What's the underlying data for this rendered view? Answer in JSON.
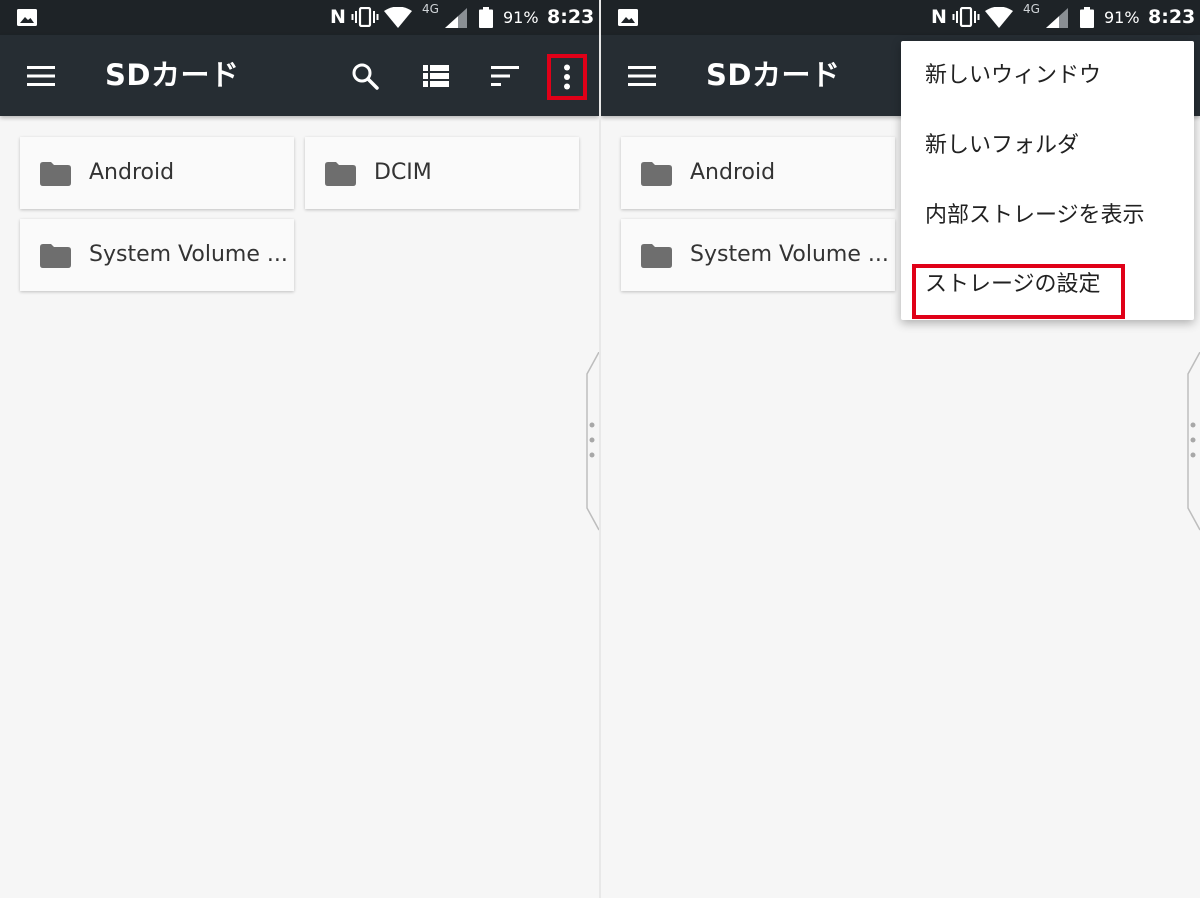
{
  "colors": {
    "status_bar": "#1e2327",
    "app_bar": "#262d33",
    "background": "#f6f6f6",
    "highlight": "#e00018",
    "folder_icon": "#6e6e6e"
  },
  "status_bar": {
    "net_type": "4G",
    "battery": "91%",
    "time": "8:23",
    "nfc": "N"
  },
  "app_bar": {
    "title": "SDカード"
  },
  "left": {
    "folders": [
      {
        "name": "Android"
      },
      {
        "name": "DCIM"
      },
      {
        "name": "System Volume ..."
      }
    ]
  },
  "right": {
    "folders": [
      {
        "name": "Android"
      },
      {
        "name": "System Volume ..."
      }
    ],
    "menu": [
      {
        "label": "新しいウィンドウ"
      },
      {
        "label": "新しいフォルダ"
      },
      {
        "label": "内部ストレージを表示"
      },
      {
        "label": "ストレージの設定"
      }
    ]
  }
}
